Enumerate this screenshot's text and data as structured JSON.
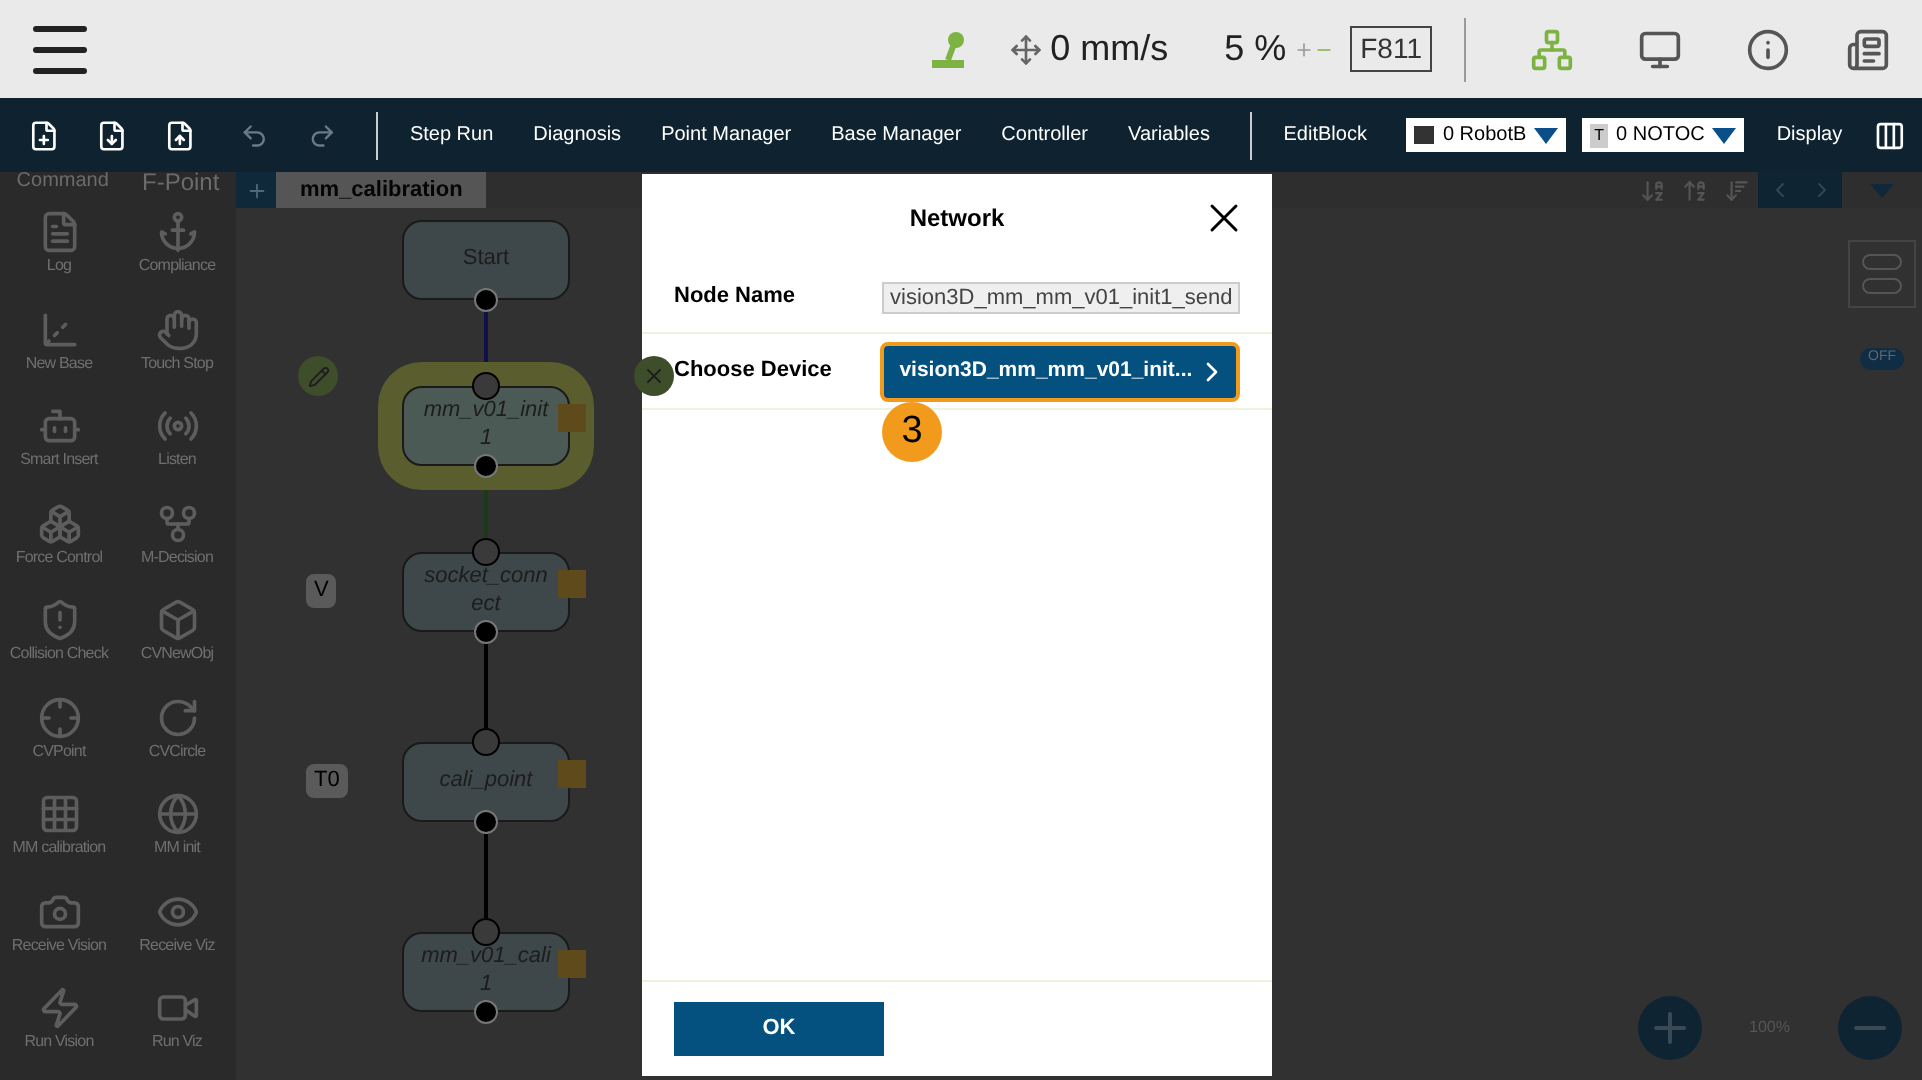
{
  "top_bar": {
    "speed": "0 mm/s",
    "speed_percent": "5 %",
    "frame": "F811"
  },
  "toolbar": {
    "items": [
      "Step Run",
      "Diagnosis",
      "Point Manager",
      "Base Manager",
      "Controller",
      "Variables"
    ],
    "edit_block": "EditBlock",
    "robot_dropdown": {
      "value": "0 RobotB"
    },
    "tool_dropdown": {
      "badge": "T",
      "value": "0 NOTOC"
    },
    "display": "Display"
  },
  "palette": {
    "header": [
      "Command",
      "F-Point"
    ],
    "items": [
      {
        "label": "Log"
      },
      {
        "label": "Compliance"
      },
      {
        "label": "New Base"
      },
      {
        "label": "Touch Stop"
      },
      {
        "label": "Smart Insert"
      },
      {
        "label": "Listen"
      },
      {
        "label": "Force Control"
      },
      {
        "label": "M-Decision"
      },
      {
        "label": "Collision Check"
      },
      {
        "label": "CVNewObj"
      },
      {
        "label": "CVPoint"
      },
      {
        "label": "CVCircle"
      },
      {
        "label": "MM calibration"
      },
      {
        "label": "MM init"
      },
      {
        "label": "Receive Vision"
      },
      {
        "label": "Receive Viz"
      },
      {
        "label": "Run Vision"
      },
      {
        "label": "Run Viz"
      }
    ]
  },
  "canvas": {
    "tab": "mm_calibration",
    "nodes": [
      {
        "label": "Start",
        "kind": "start",
        "selected": false
      },
      {
        "label": "mm_v01_init1",
        "kind": "task",
        "selected": true
      },
      {
        "label": "socket_connect",
        "kind": "task",
        "tag": "V",
        "selected": false
      },
      {
        "label": "cali_point",
        "kind": "task",
        "tag": "T0",
        "selected": false
      },
      {
        "label": "mm_v01_cali1",
        "kind": "task",
        "selected": false
      }
    ],
    "toggle": {
      "label": "OFF",
      "on": false
    },
    "zoom": "100%"
  },
  "dialog": {
    "title": "Network",
    "rows": [
      {
        "kind": "field",
        "label": "Node Name",
        "value": "vision3D_mm_mm_v01_init1_send"
      },
      {
        "kind": "picker",
        "label": "Choose Device",
        "value": "vision3D_mm_mm_v01_init..."
      }
    ],
    "step_badge": "3",
    "ok": "OK"
  }
}
